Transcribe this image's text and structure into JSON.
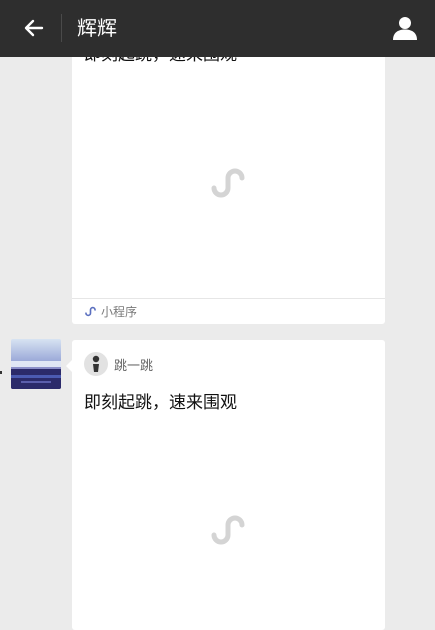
{
  "header": {
    "title": "辉辉",
    "back_icon": "arrow-left-icon",
    "profile_icon": "person-icon"
  },
  "messages": [
    {
      "type": "mini-program-card",
      "title": "即刻起跳，速来围观",
      "placeholder_icon": "mini-program-icon",
      "footer_label": "小程序"
    },
    {
      "type": "mini-program-card",
      "source_name": "跳一跳",
      "title": "即刻起跳，速来围观",
      "placeholder_icon": "mini-program-icon"
    }
  ],
  "colors": {
    "header_bg": "#2e2e2e",
    "page_bg": "#ebebeb",
    "card_bg": "#ffffff",
    "placeholder_icon": "#d4d4d4",
    "mini_program_accent": "#5a6fbf"
  }
}
